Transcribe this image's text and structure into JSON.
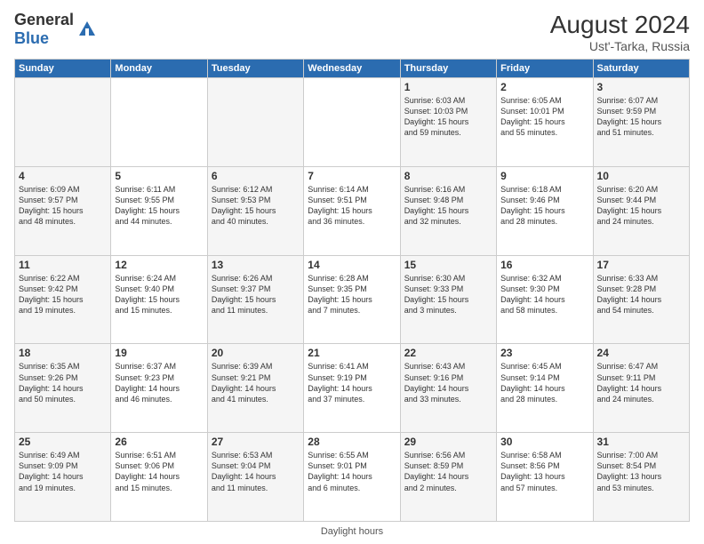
{
  "header": {
    "logo_general": "General",
    "logo_blue": "Blue",
    "month_year": "August 2024",
    "location": "Ust'-Tarka, Russia"
  },
  "weekdays": [
    "Sunday",
    "Monday",
    "Tuesday",
    "Wednesday",
    "Thursday",
    "Friday",
    "Saturday"
  ],
  "footer_label": "Daylight hours",
  "weeks": [
    [
      {
        "day": "",
        "info": ""
      },
      {
        "day": "",
        "info": ""
      },
      {
        "day": "",
        "info": ""
      },
      {
        "day": "",
        "info": ""
      },
      {
        "day": "1",
        "info": "Sunrise: 6:03 AM\nSunset: 10:03 PM\nDaylight: 15 hours\nand 59 minutes."
      },
      {
        "day": "2",
        "info": "Sunrise: 6:05 AM\nSunset: 10:01 PM\nDaylight: 15 hours\nand 55 minutes."
      },
      {
        "day": "3",
        "info": "Sunrise: 6:07 AM\nSunset: 9:59 PM\nDaylight: 15 hours\nand 51 minutes."
      }
    ],
    [
      {
        "day": "4",
        "info": "Sunrise: 6:09 AM\nSunset: 9:57 PM\nDaylight: 15 hours\nand 48 minutes."
      },
      {
        "day": "5",
        "info": "Sunrise: 6:11 AM\nSunset: 9:55 PM\nDaylight: 15 hours\nand 44 minutes."
      },
      {
        "day": "6",
        "info": "Sunrise: 6:12 AM\nSunset: 9:53 PM\nDaylight: 15 hours\nand 40 minutes."
      },
      {
        "day": "7",
        "info": "Sunrise: 6:14 AM\nSunset: 9:51 PM\nDaylight: 15 hours\nand 36 minutes."
      },
      {
        "day": "8",
        "info": "Sunrise: 6:16 AM\nSunset: 9:48 PM\nDaylight: 15 hours\nand 32 minutes."
      },
      {
        "day": "9",
        "info": "Sunrise: 6:18 AM\nSunset: 9:46 PM\nDaylight: 15 hours\nand 28 minutes."
      },
      {
        "day": "10",
        "info": "Sunrise: 6:20 AM\nSunset: 9:44 PM\nDaylight: 15 hours\nand 24 minutes."
      }
    ],
    [
      {
        "day": "11",
        "info": "Sunrise: 6:22 AM\nSunset: 9:42 PM\nDaylight: 15 hours\nand 19 minutes."
      },
      {
        "day": "12",
        "info": "Sunrise: 6:24 AM\nSunset: 9:40 PM\nDaylight: 15 hours\nand 15 minutes."
      },
      {
        "day": "13",
        "info": "Sunrise: 6:26 AM\nSunset: 9:37 PM\nDaylight: 15 hours\nand 11 minutes."
      },
      {
        "day": "14",
        "info": "Sunrise: 6:28 AM\nSunset: 9:35 PM\nDaylight: 15 hours\nand 7 minutes."
      },
      {
        "day": "15",
        "info": "Sunrise: 6:30 AM\nSunset: 9:33 PM\nDaylight: 15 hours\nand 3 minutes."
      },
      {
        "day": "16",
        "info": "Sunrise: 6:32 AM\nSunset: 9:30 PM\nDaylight: 14 hours\nand 58 minutes."
      },
      {
        "day": "17",
        "info": "Sunrise: 6:33 AM\nSunset: 9:28 PM\nDaylight: 14 hours\nand 54 minutes."
      }
    ],
    [
      {
        "day": "18",
        "info": "Sunrise: 6:35 AM\nSunset: 9:26 PM\nDaylight: 14 hours\nand 50 minutes."
      },
      {
        "day": "19",
        "info": "Sunrise: 6:37 AM\nSunset: 9:23 PM\nDaylight: 14 hours\nand 46 minutes."
      },
      {
        "day": "20",
        "info": "Sunrise: 6:39 AM\nSunset: 9:21 PM\nDaylight: 14 hours\nand 41 minutes."
      },
      {
        "day": "21",
        "info": "Sunrise: 6:41 AM\nSunset: 9:19 PM\nDaylight: 14 hours\nand 37 minutes."
      },
      {
        "day": "22",
        "info": "Sunrise: 6:43 AM\nSunset: 9:16 PM\nDaylight: 14 hours\nand 33 minutes."
      },
      {
        "day": "23",
        "info": "Sunrise: 6:45 AM\nSunset: 9:14 PM\nDaylight: 14 hours\nand 28 minutes."
      },
      {
        "day": "24",
        "info": "Sunrise: 6:47 AM\nSunset: 9:11 PM\nDaylight: 14 hours\nand 24 minutes."
      }
    ],
    [
      {
        "day": "25",
        "info": "Sunrise: 6:49 AM\nSunset: 9:09 PM\nDaylight: 14 hours\nand 19 minutes."
      },
      {
        "day": "26",
        "info": "Sunrise: 6:51 AM\nSunset: 9:06 PM\nDaylight: 14 hours\nand 15 minutes."
      },
      {
        "day": "27",
        "info": "Sunrise: 6:53 AM\nSunset: 9:04 PM\nDaylight: 14 hours\nand 11 minutes."
      },
      {
        "day": "28",
        "info": "Sunrise: 6:55 AM\nSunset: 9:01 PM\nDaylight: 14 hours\nand 6 minutes."
      },
      {
        "day": "29",
        "info": "Sunrise: 6:56 AM\nSunset: 8:59 PM\nDaylight: 14 hours\nand 2 minutes."
      },
      {
        "day": "30",
        "info": "Sunrise: 6:58 AM\nSunset: 8:56 PM\nDaylight: 13 hours\nand 57 minutes."
      },
      {
        "day": "31",
        "info": "Sunrise: 7:00 AM\nSunset: 8:54 PM\nDaylight: 13 hours\nand 53 minutes."
      }
    ]
  ]
}
